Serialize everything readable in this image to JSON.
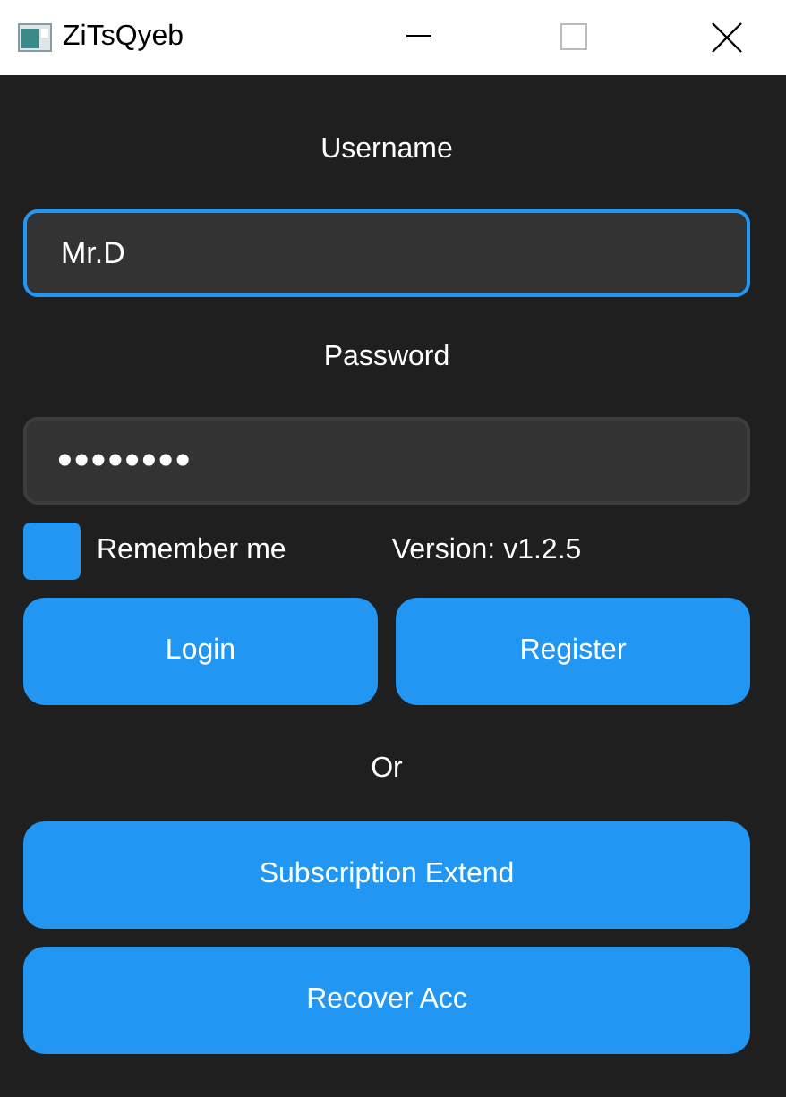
{
  "window": {
    "title": "ZiTsQyeb"
  },
  "username": {
    "label": "Username",
    "value": "Mr.D",
    "focused": true
  },
  "password": {
    "label": "Password",
    "value": "••••••••",
    "focused": false
  },
  "remember": {
    "label": "Remember me",
    "checked": false
  },
  "version": "Version: v1.2.5",
  "buttons": [
    {
      "label": "Login"
    },
    {
      "label": "Register"
    }
  ],
  "separator": "Or",
  "actions": [
    {
      "label": "Subscription Extend"
    },
    {
      "label": "Recover Acc"
    }
  ]
}
